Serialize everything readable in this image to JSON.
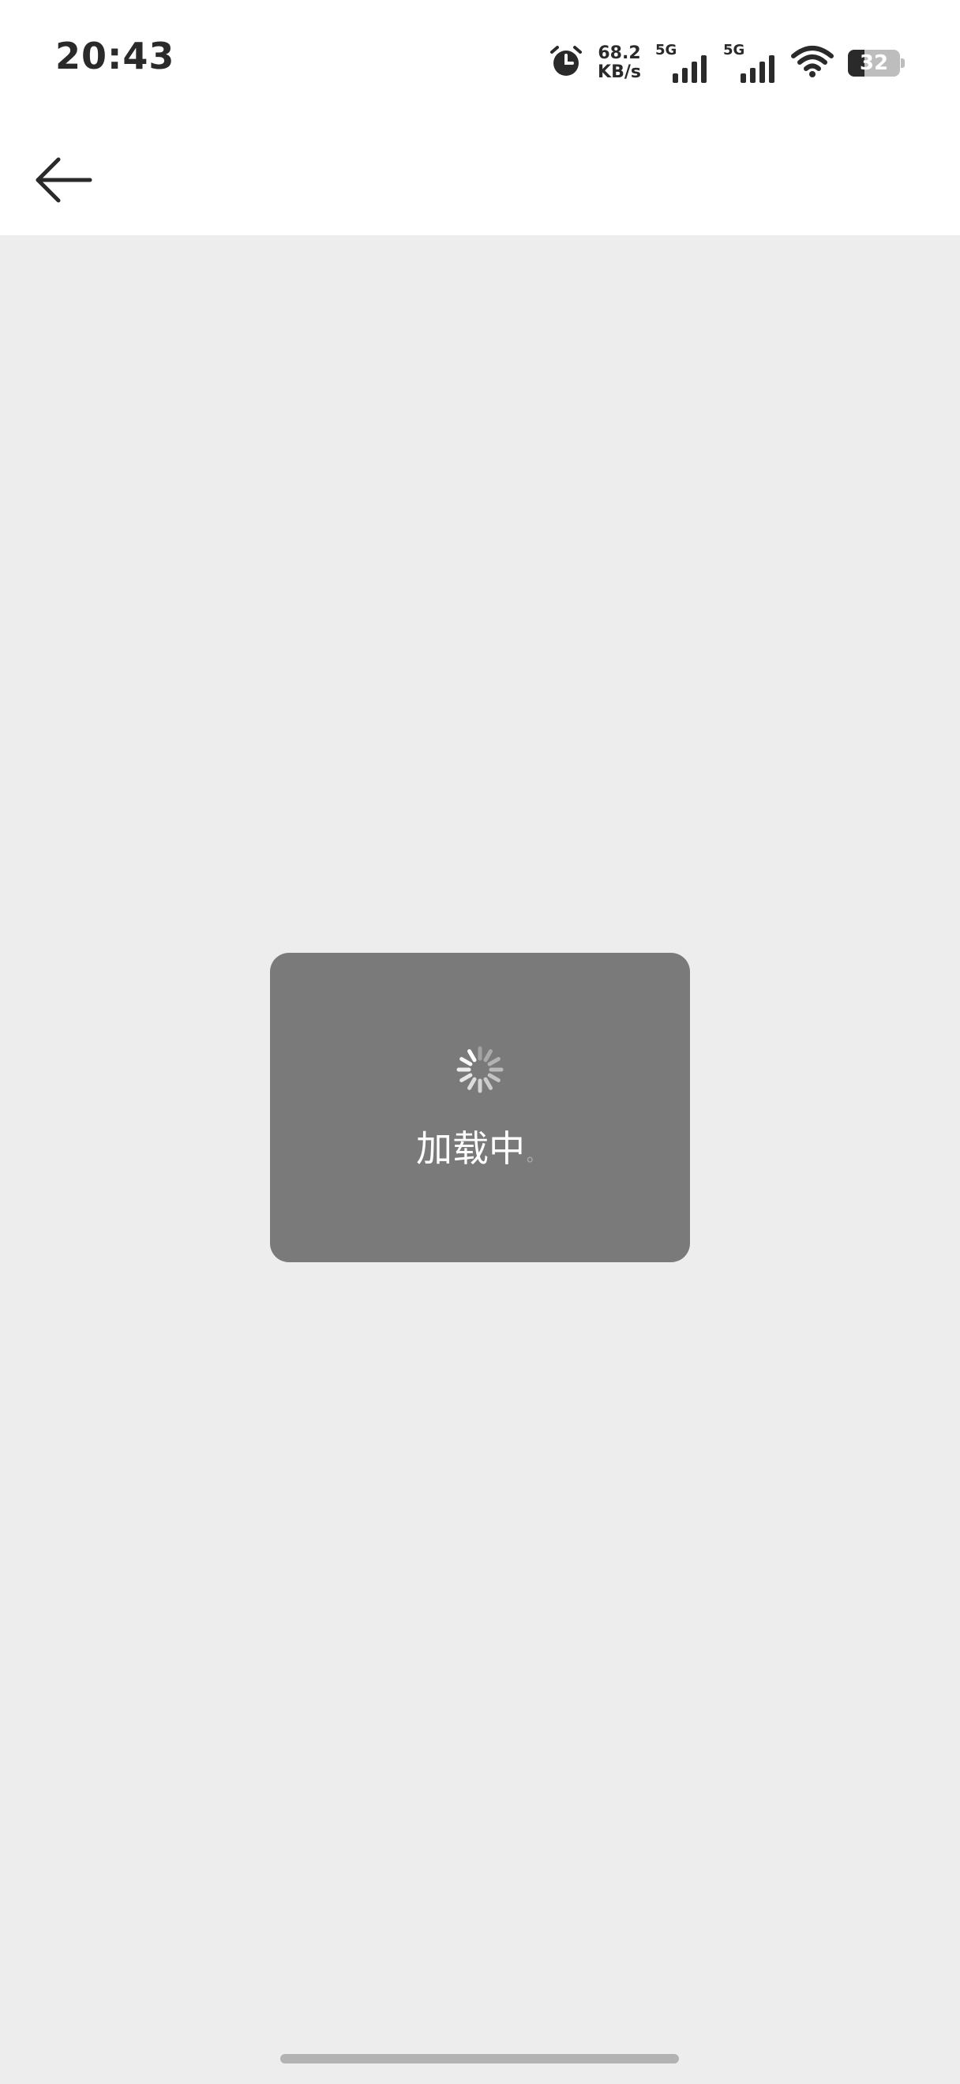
{
  "status_bar": {
    "time": "20:43",
    "net_speed_value": "68.2",
    "net_speed_unit": "KB/s",
    "sim1_type": "5G",
    "sim2_type": "5G",
    "battery_level": "32",
    "battery_fraction": 0.32,
    "icons": [
      "alarm-icon",
      "signal-icon",
      "signal-icon",
      "wifi-icon",
      "battery-icon"
    ]
  },
  "nav": {
    "back_icon": "arrow-left-icon"
  },
  "loading": {
    "text": "加载中",
    "trailing": "。",
    "icon": "spinner-icon"
  },
  "colors": {
    "background": "#ededed",
    "toast": "#7a7a7a",
    "text_dark": "#2a2a2a"
  }
}
